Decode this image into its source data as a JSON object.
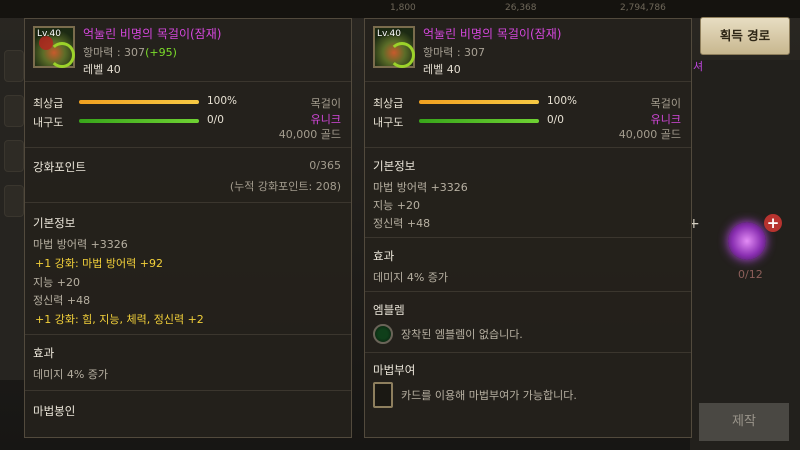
{
  "topbar": {
    "values": [
      "1,800",
      "26,368",
      "2,794,786"
    ]
  },
  "background": {
    "item_count": "0/12",
    "craft_label": "제작",
    "side_text": "셔"
  },
  "acquire_button": "획득 경로",
  "item1": {
    "level_badge": "Lv.40",
    "name": "억눌린 비명의 목걸이(잠재)",
    "stat": "항마력 : 307",
    "stat_bonus": "(+95)",
    "level": "레벨 40",
    "grade_label": "최상급",
    "grade_pct": "100%",
    "grade_value": 100,
    "durability_label": "내구도",
    "durability_text": "0/0",
    "durability_value": 100,
    "slot": "목걸이",
    "rarity": "유니크",
    "price": "40,000 골드",
    "reinforce_label": "강화포인트",
    "reinforce_value": "0/365",
    "reinforce_total": "(누적 강화포인트: 208)",
    "basic_title": "기본정보",
    "basic_lines": [
      "마법 방어력 +3326",
      "+1 강화: 마법 방어력 +92",
      "지능 +20",
      "정신력 +48",
      "+1 강화: 힘, 지능, 체력, 정신력 +2"
    ],
    "effect_title": "효과",
    "effect_text": "데미지 4% 증가",
    "seal_title": "마법봉인"
  },
  "item2": {
    "level_badge": "Lv.40",
    "name": "억눌린 비명의 목걸이(잠재)",
    "stat": "항마력 : 307",
    "level": "레벨 40",
    "grade_label": "최상급",
    "grade_pct": "100%",
    "grade_value": 100,
    "durability_label": "내구도",
    "durability_text": "0/0",
    "durability_value": 100,
    "slot": "목걸이",
    "rarity": "유니크",
    "price": "40,000 골드",
    "basic_title": "기본정보",
    "basic_lines": [
      "마법 방어력 +3326",
      "지능 +20",
      "정신력 +48"
    ],
    "effect_title": "효과",
    "effect_text": "데미지 4% 증가",
    "emblem_title": "엠블렘",
    "emblem_text": "장착된 엠블렘이 없습니다.",
    "enchant_title": "마법부여",
    "enchant_text": "카드를 이용해 마법부여가 가능합니다."
  },
  "colors": {
    "name": "#d547dd",
    "bonus": "#7bdc2a",
    "reinforce": "#f2d03a",
    "grade_bar": "#f0a020",
    "durability_bar": "#38a51a"
  }
}
